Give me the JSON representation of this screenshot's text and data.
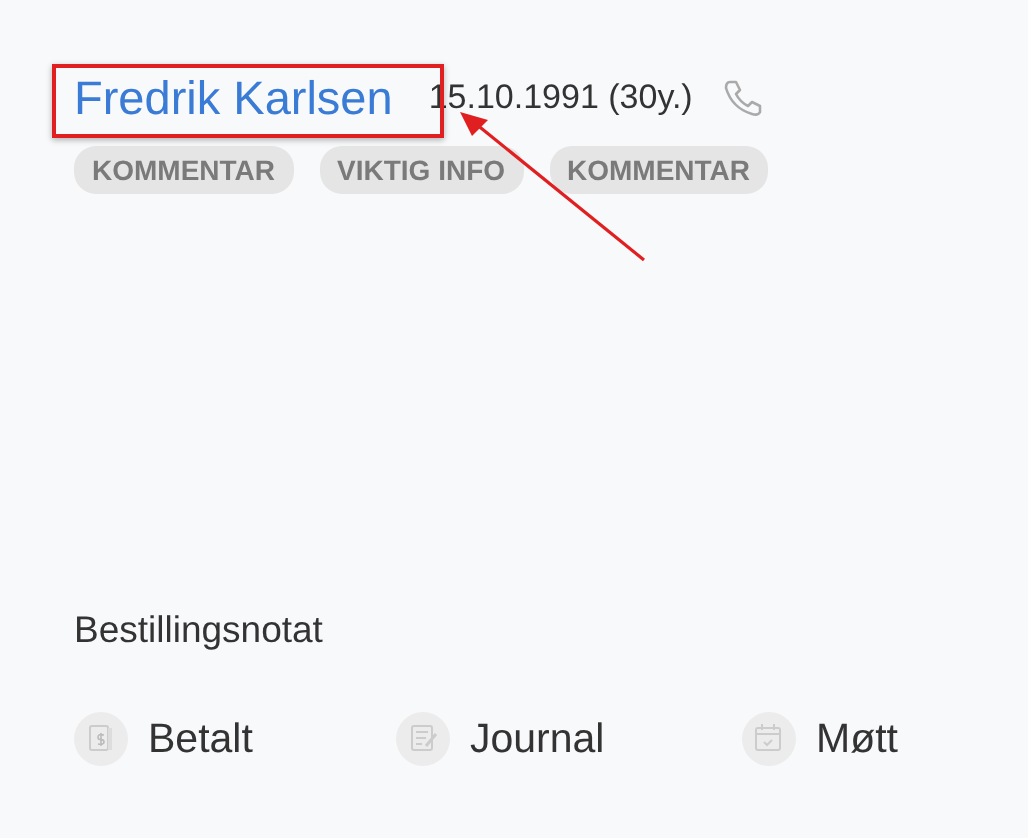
{
  "patient": {
    "name": "Fredrik Karlsen",
    "birth": "15.10.1991 (30y.)",
    "highlighted": true
  },
  "tags": [
    {
      "label": "KOMMENTAR"
    },
    {
      "label": "VIKTIG INFO"
    },
    {
      "label": "KOMMENTAR"
    }
  ],
  "note_label": "Bestillingsnotat",
  "statuses": [
    {
      "kind": "paid",
      "label": "Betalt"
    },
    {
      "kind": "journal",
      "label": "Journal"
    },
    {
      "kind": "attended",
      "label": "Møtt"
    }
  ]
}
